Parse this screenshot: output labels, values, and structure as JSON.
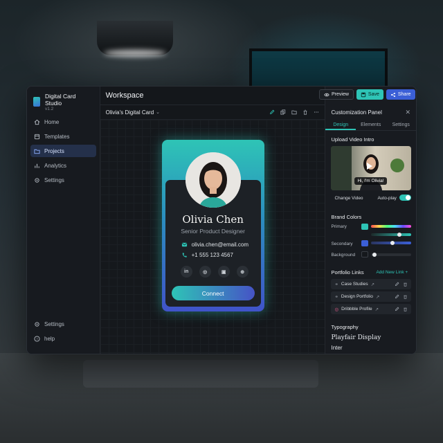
{
  "app": {
    "name": "Digital Card Studio",
    "version": "v1.2"
  },
  "sidebar": {
    "items": [
      {
        "label": "Home",
        "icon": "home-icon"
      },
      {
        "label": "Templates",
        "icon": "template-icon"
      },
      {
        "label": "Projects",
        "icon": "folder-icon",
        "active": true
      },
      {
        "label": "Analytics",
        "icon": "chart-icon"
      },
      {
        "label": "Settings",
        "icon": "gear-icon"
      }
    ],
    "bottom": [
      {
        "label": "Settings",
        "icon": "gear-icon"
      },
      {
        "label": "help",
        "icon": "help-icon"
      }
    ]
  },
  "header": {
    "title": "Workspace",
    "preview_label": "Preview",
    "save_label": "Save",
    "share_label": "Share"
  },
  "editor": {
    "card_name": "Olivia's Digital Card"
  },
  "card": {
    "name": "Olivia Chen",
    "role": "Senior Product Designer",
    "email": "olivia.chen@email.com",
    "phone": "+1 555 123 4567",
    "socials": [
      "in",
      "◎",
      "▣",
      "⊕"
    ],
    "connect_label": "Connect"
  },
  "panel": {
    "title": "Customization Panel",
    "tabs": [
      "Design",
      "Elements",
      "Settings"
    ],
    "active_tab": "Design",
    "video": {
      "section": "Upload Video Intro",
      "overlay": "Hi, I'm Olivia!",
      "change_label": "Change Video",
      "autoplay_label": "Auto-play",
      "autoplay": true
    },
    "brand_colors": {
      "section": "Brand Colors",
      "primary_label": "Primary",
      "secondary_label": "Secondary",
      "background_label": "Background",
      "primary": "#2ec4b6",
      "secondary": "#3b5fd6",
      "background": "#15181c"
    },
    "portfolio": {
      "section": "Portfolio Links",
      "add_label": "Add New Link +",
      "links": [
        "Case Studies",
        "Design Portfolio",
        "Dribbble Profile"
      ]
    },
    "typography": {
      "section": "Typography",
      "heading_font": "Playfair Display",
      "body_font": "Inter"
    }
  }
}
